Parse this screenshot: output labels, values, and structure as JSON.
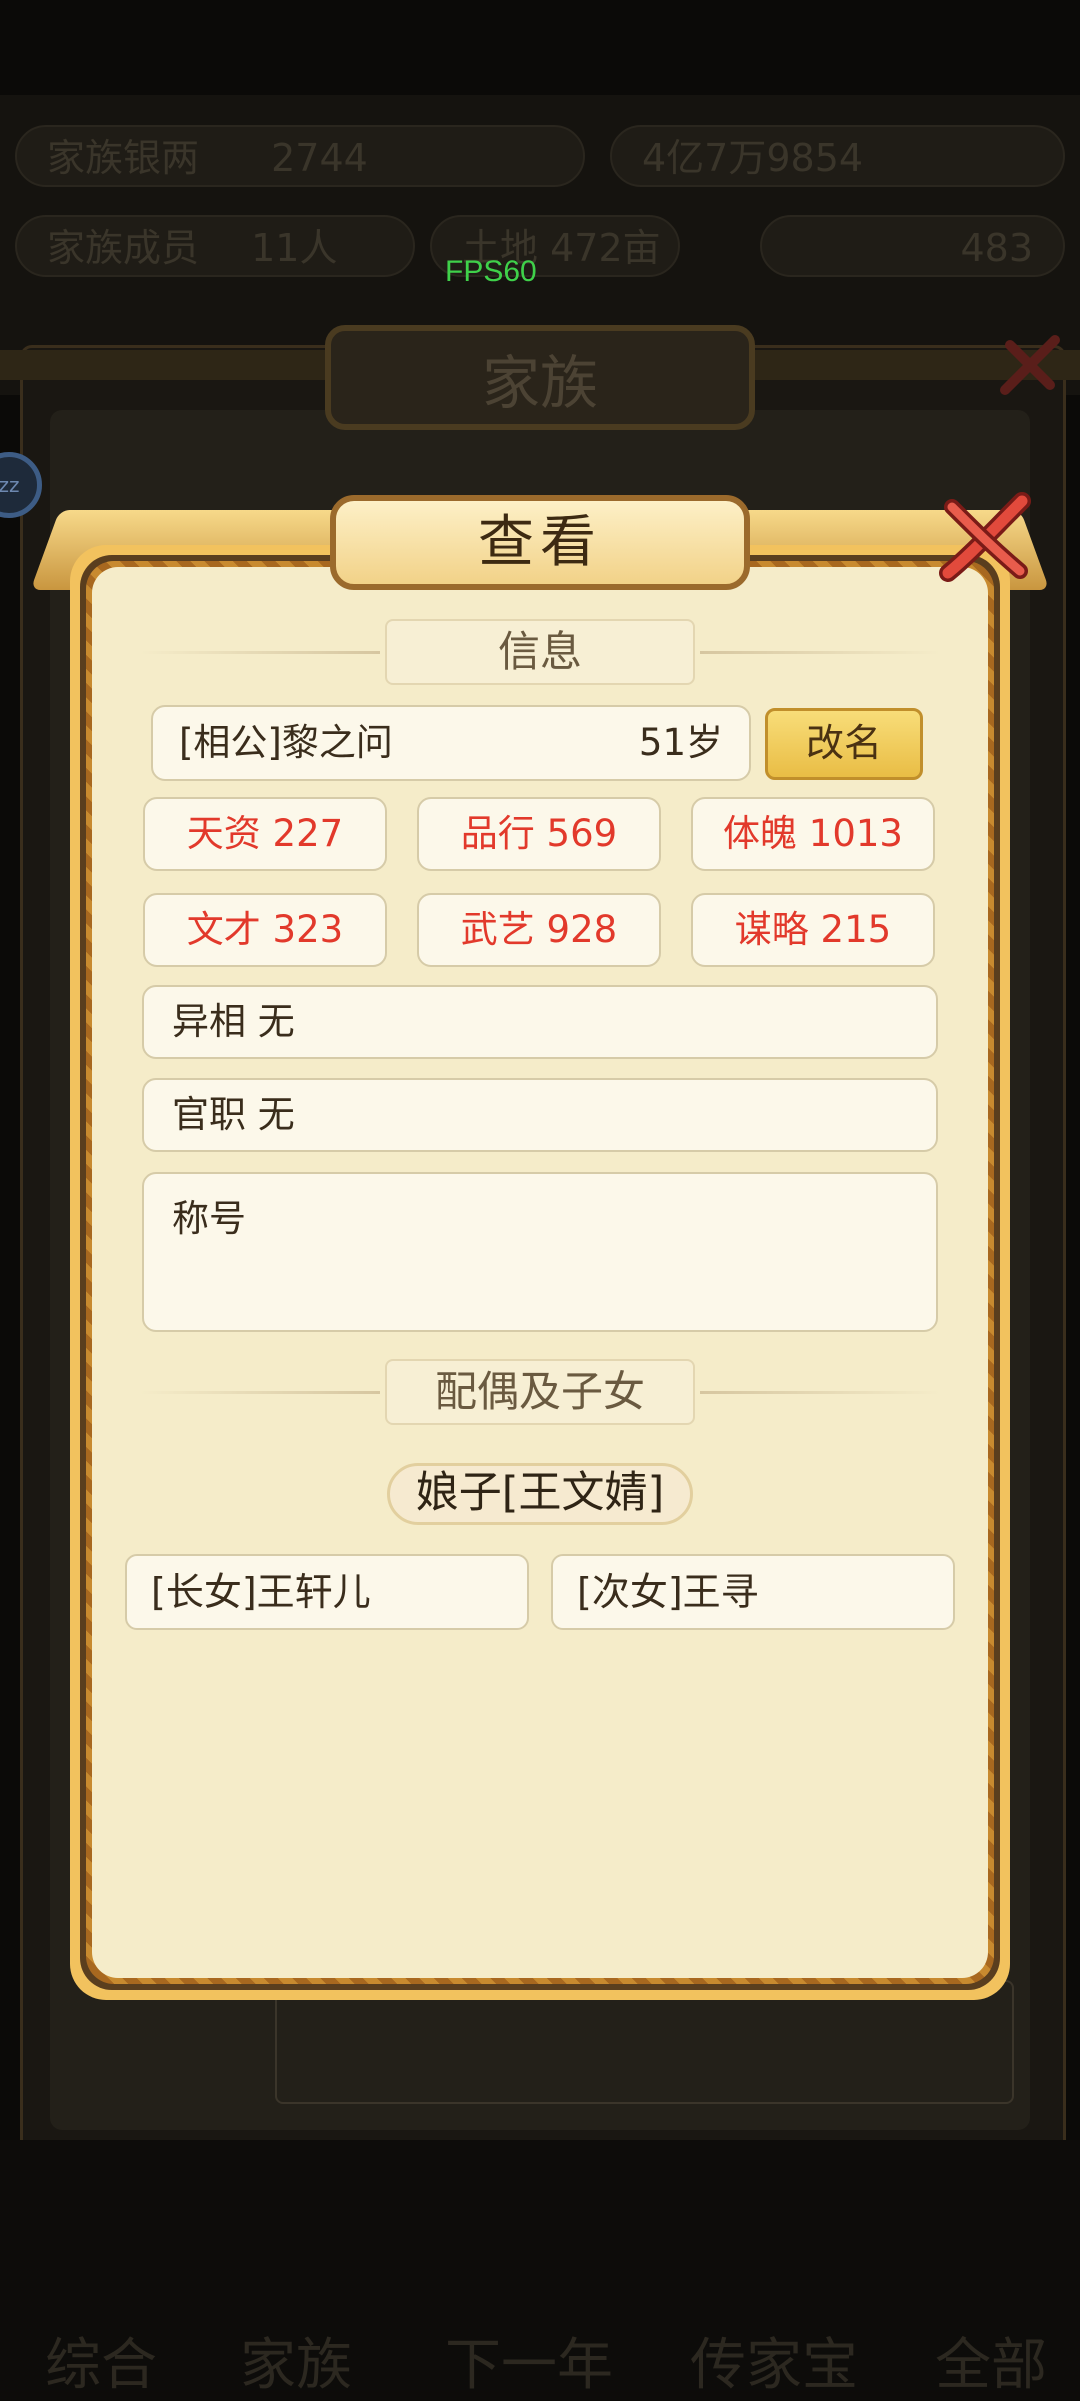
{
  "fps": "FPS60",
  "background": {
    "title": "家族",
    "nav": [
      "综合",
      "家族",
      "下一年",
      "传家宝",
      "全部"
    ],
    "top_row1": [
      "家族银两",
      "2744",
      "4亿7万9854"
    ],
    "top_row2": [
      "家族成员",
      "11人",
      "土地",
      "472亩",
      "483"
    ],
    "bubble": "zz"
  },
  "dialog": {
    "title": "查看",
    "info_section": "信息",
    "member": {
      "name": "[相公]黎之问",
      "age": "51岁",
      "rename_label": "改名"
    },
    "stats": [
      {
        "label": "天资 227"
      },
      {
        "label": "品行 569"
      },
      {
        "label": "体魄 1013"
      },
      {
        "label": "文才 323"
      },
      {
        "label": "武艺 928"
      },
      {
        "label": "谋略 215"
      }
    ],
    "trait": "异相 无",
    "office": "官职 无",
    "honor_label": "称号",
    "family_section": "配偶及子女",
    "spouse": "娘子[王文婧]",
    "children": [
      "[长女]王轩儿",
      "[次女]王寻"
    ]
  },
  "colors": {
    "stat_text": "#e2392b",
    "panel_bg": "#f5ecc9",
    "frame_gold": "#f2c25e",
    "rename_bg": "#e9bd45"
  }
}
